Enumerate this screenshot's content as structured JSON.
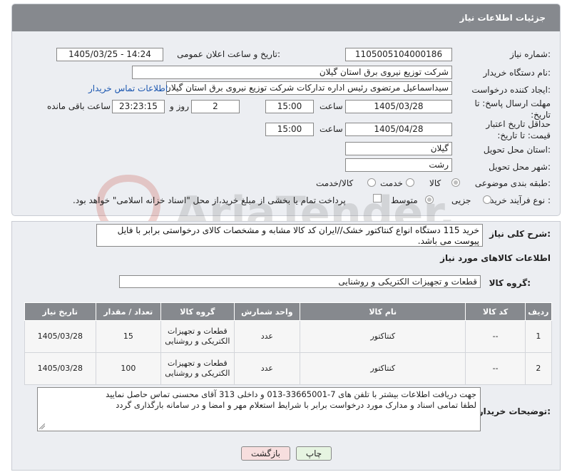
{
  "panel": {
    "title": "جزئیات اطلاعات نیاز"
  },
  "fields": {
    "need_number_label": "شماره نیاز:",
    "need_number": "1105005104000186",
    "announce_label": "تاریخ و ساعت اعلان عمومی:",
    "announce_value": "1405/03/25 - 14:24",
    "buyer_org_label": "نام دستگاه خریدار:",
    "buyer_org": "شرکت توزیع نیروی برق استان گیلان",
    "creator_label": "ایجاد کننده درخواست:",
    "creator": "سیداسماعیل مرتضوی رئیس اداره تدارکات شرکت توزیع نیروی برق استان گیلان",
    "contact_link": "اطلاعات تماس خریدار",
    "deadline_label": "مهلت ارسال پاسخ: تا تاریخ:",
    "deadline_date": "1405/03/28",
    "time_label": "ساعت",
    "deadline_time": "15:00",
    "days_value": "2",
    "days_label": "روز و",
    "remaining_time": "23:23:15",
    "remaining_label": "ساعت باقی مانده",
    "validity_label": "حداقل تاریخ اعتبار قیمت: تا تاریخ:",
    "validity_date": "1405/04/28",
    "validity_time": "15:00",
    "province_label": "استان محل تحویل:",
    "province": "گیلان",
    "city_label": "شهر محل تحویل:",
    "city": "رشت",
    "category_label": "طبقه بندی موضوعی:",
    "category_options": [
      "کالا",
      "خدمت",
      "کالا/خدمت"
    ],
    "purchase_type_label": "نوع فرآیند خرید :",
    "purchase_options": [
      "جزیی",
      "متوسط"
    ],
    "payment_note": "پرداخت تمام یا بخشی از مبلغ خرید،از محل \"اسناد خزانه اسلامی\" خواهد بود."
  },
  "general_desc": {
    "label": "شرح کلی نیاز:",
    "text": "خرید 115 دستگاه انواع کنتاکتور خشک//ایران کد کالا مشابه و مشخصات کالای درخواستی برابر با فایل پیوست می باشد."
  },
  "goods_info_label": "اطلاعات کالاهای مورد نیاز",
  "goods_group": {
    "label": "گروه کالا:",
    "value": "قطعات و تجهیزات الکتریکی و روشنایی"
  },
  "table": {
    "headers": [
      "ردیف",
      "کد کالا",
      "نام کالا",
      "واحد شمارش",
      "گروه کالا",
      "تعداد / مقدار",
      "تاریخ نیاز"
    ],
    "rows": [
      {
        "row": "1",
        "code": "--",
        "name": "کنتاکتور",
        "unit": "عدد",
        "group": "قطعات و تجهیزات الکتریکی و روشنایی",
        "qty": "15",
        "date": "1405/03/28"
      },
      {
        "row": "2",
        "code": "--",
        "name": "کنتاکتور",
        "unit": "عدد",
        "group": "قطعات و تجهیزات الکتریکی و روشنایی",
        "qty": "100",
        "date": "1405/03/28"
      }
    ]
  },
  "buyer_notes": {
    "label": "توضیحات خریدار:",
    "line1": "جهت دریافت اطلاعات بیشتر با تلفن های 7-33665001-013 و داخلی 313 آقای محسنی تماس حاصل نمایید",
    "line2": "لطفا تمامی اسناد و مدارک مورد درخواست برابر با شرایط استعلام مهر و امضا و در سامانه بارگذاری گردد"
  },
  "buttons": {
    "print": "چاپ",
    "back": "بازگشت"
  },
  "watermark_text": "AriaTender.net",
  "colors": {
    "header": "#86898e",
    "link": "#1a56b0",
    "panel": "#eceef2",
    "back_button": "#f7dede",
    "print_button": "#e6f4e1"
  }
}
